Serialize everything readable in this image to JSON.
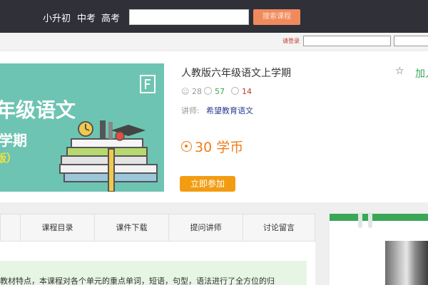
{
  "nav": {
    "links": [
      "小升初",
      "中考",
      "高考"
    ],
    "search_placeholder": "",
    "search_button": "搜索课程"
  },
  "login": {
    "link": "请登录"
  },
  "course": {
    "cover_text": [
      "年级语文",
      "学期",
      "版）"
    ],
    "title": "人教版六年级语文上学期",
    "join_text": "加入",
    "stats": {
      "students": "28",
      "views": "57",
      "comments": "14"
    },
    "teacher_label": "讲师:",
    "teacher_name": "希望教育语文",
    "price": "30 学币",
    "enroll_button": "立即参加"
  },
  "tabs": [
    "",
    "课程目录",
    "课件下载",
    "提问讲师",
    "讨论留言"
  ],
  "description": "教材特点，本课程对各个单元的重点单词，短语，句型，语法进行了全方位的归",
  "colors": {
    "nav_bg": "#2f3038",
    "accent_orange": "#f39c12",
    "price_orange": "#ef7d1a",
    "green": "#3aa757",
    "cover_teal": "#6ec4b2"
  }
}
